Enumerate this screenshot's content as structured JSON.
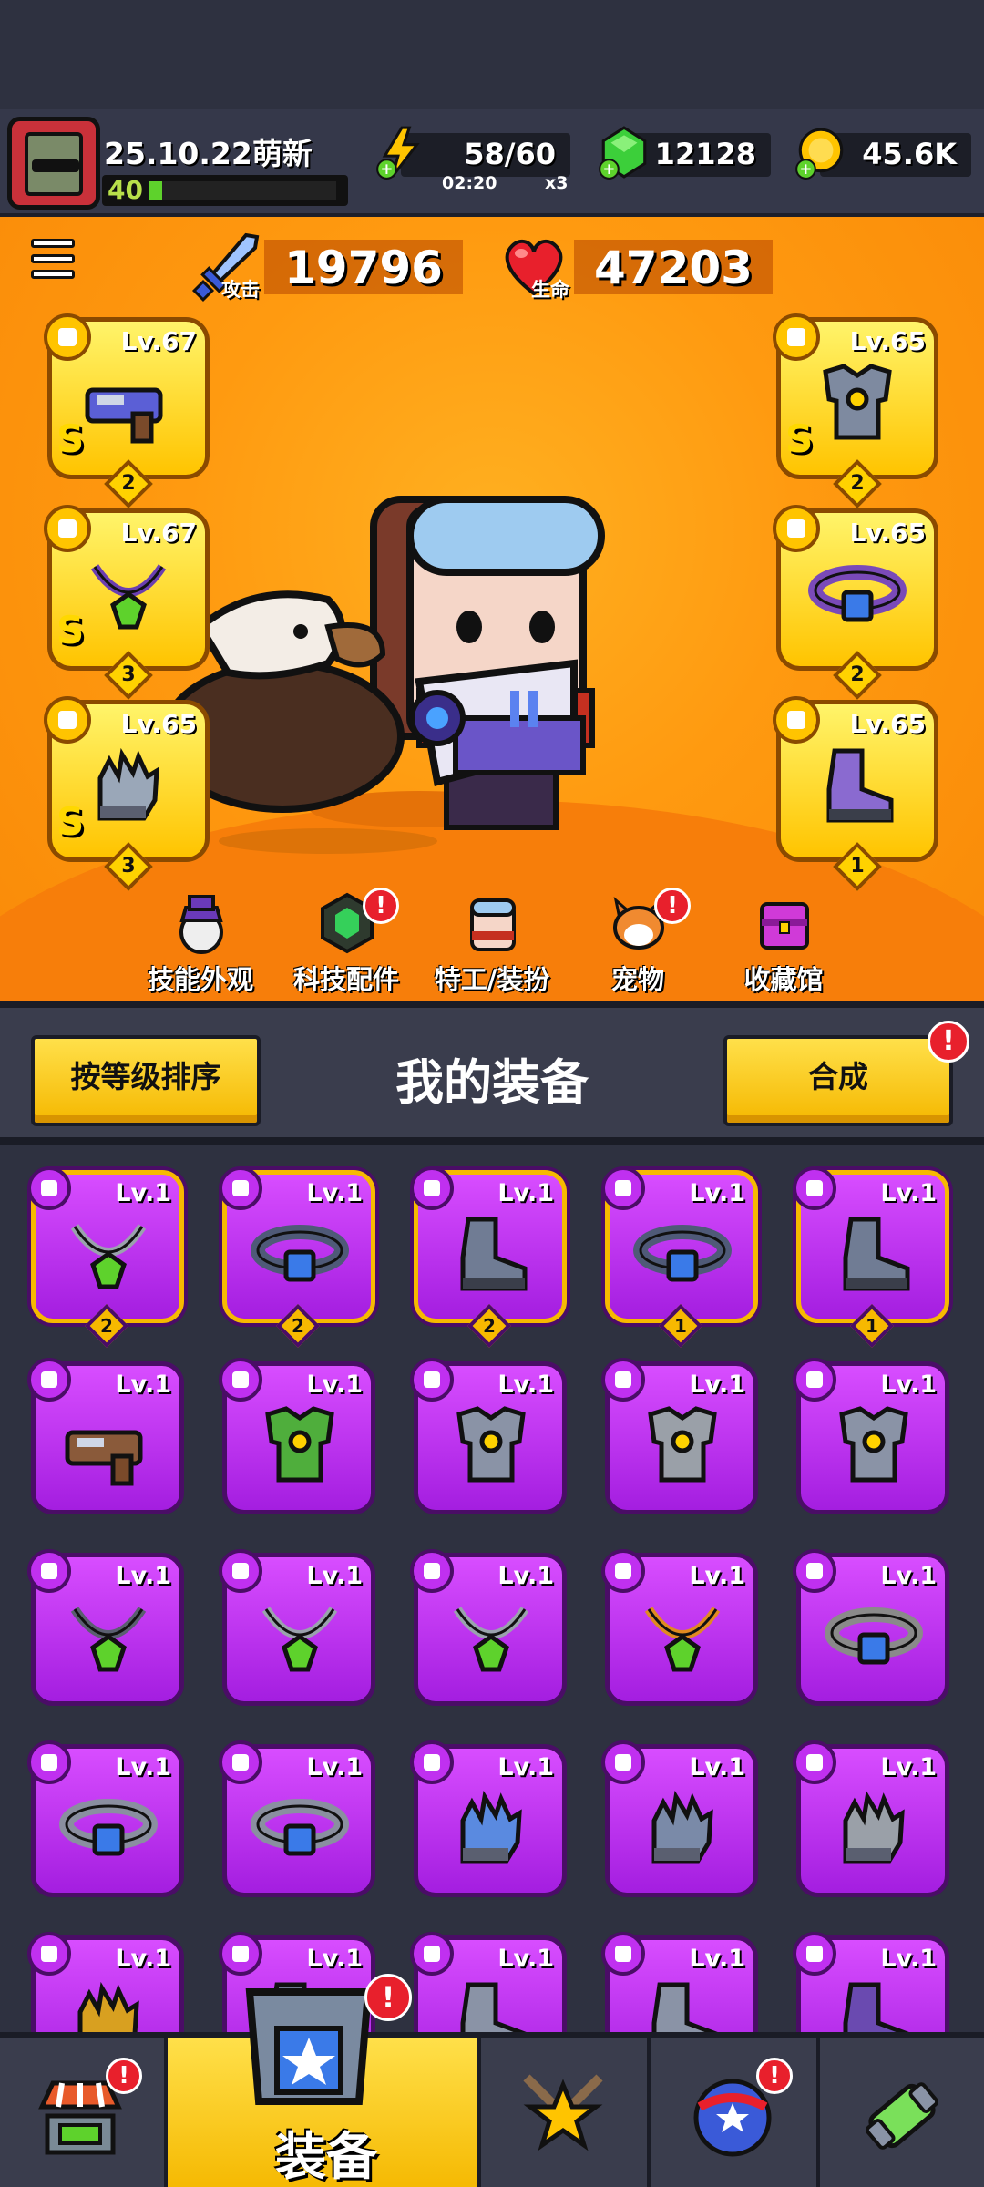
{
  "player": {
    "name": "25.10.22萌新",
    "level": "40",
    "xp_fraction": 0.07
  },
  "resources": {
    "energy": {
      "value": "58/60",
      "timer": "02:20",
      "multiplier": "x3"
    },
    "gems": {
      "value": "12128"
    },
    "gold": {
      "value": "45.6K"
    }
  },
  "stats": {
    "attack": {
      "label": "攻击",
      "value": "19796"
    },
    "hp": {
      "label": "生命",
      "value": "47203"
    }
  },
  "equipped": [
    {
      "slot": "weapon",
      "level": "Lv.67",
      "rank": "S",
      "count": "2",
      "color": "#5b5fd6"
    },
    {
      "slot": "necklace",
      "level": "Lv.67",
      "rank": "S",
      "count": "3",
      "color": "#6b3fb0"
    },
    {
      "slot": "gloves",
      "level": "Lv.65",
      "rank": "S",
      "count": "3",
      "color": "#9aa7b8"
    },
    {
      "slot": "armor",
      "level": "Lv.65",
      "rank": "S",
      "count": "2",
      "color": "#7e8aa0"
    },
    {
      "slot": "belt",
      "level": "Lv.65",
      "rank": "",
      "count": "2",
      "color": "#7a4ab8"
    },
    {
      "slot": "boots",
      "level": "Lv.65",
      "rank": "",
      "count": "1",
      "color": "#8a6ad0"
    }
  ],
  "hero_nav": [
    {
      "label": "技能外观",
      "alert": false
    },
    {
      "label": "科技配件",
      "alert": true
    },
    {
      "label": "特工/装扮",
      "alert": false
    },
    {
      "label": "宠物",
      "alert": true
    },
    {
      "label": "收藏馆",
      "alert": false
    }
  ],
  "equipment_header": {
    "sort_label": "按等级排序",
    "title": "我的装备",
    "merge_label": "合成",
    "merge_alert": "!"
  },
  "inventory": [
    {
      "type": "necklace",
      "level": "Lv.1",
      "count": "2",
      "gold": true,
      "color": "#9aa2ad"
    },
    {
      "type": "belt",
      "level": "Lv.1",
      "count": "2",
      "gold": true,
      "color": "#4f5a78"
    },
    {
      "type": "boots",
      "level": "Lv.1",
      "count": "2",
      "gold": true,
      "color": "#707c94"
    },
    {
      "type": "belt",
      "level": "Lv.1",
      "count": "1",
      "gold": true,
      "color": "#4f5a78"
    },
    {
      "type": "boots",
      "level": "Lv.1",
      "count": "1",
      "gold": true,
      "color": "#707c94"
    },
    {
      "type": "weapon",
      "level": "Lv.1",
      "count": "",
      "gold": false,
      "color": "#8a5a3a"
    },
    {
      "type": "armor",
      "level": "Lv.1",
      "count": "",
      "gold": false,
      "color": "#4fae3c"
    },
    {
      "type": "armor",
      "level": "Lv.1",
      "count": "",
      "gold": false,
      "color": "#8a93a6"
    },
    {
      "type": "armor",
      "level": "Lv.1",
      "count": "",
      "gold": false,
      "color": "#9aa0a8"
    },
    {
      "type": "armor",
      "level": "Lv.1",
      "count": "",
      "gold": false,
      "color": "#8a93a6"
    },
    {
      "type": "necklace",
      "level": "Lv.1",
      "count": "",
      "gold": false,
      "color": "#5a5f70"
    },
    {
      "type": "necklace",
      "level": "Lv.1",
      "count": "",
      "gold": false,
      "color": "#9aa2ad"
    },
    {
      "type": "necklace",
      "level": "Lv.1",
      "count": "",
      "gold": false,
      "color": "#9aa2ad"
    },
    {
      "type": "necklace",
      "level": "Lv.1",
      "count": "",
      "gold": false,
      "color": "#e08a20"
    },
    {
      "type": "belt",
      "level": "Lv.1",
      "count": "",
      "gold": false,
      "color": "#8a8a8a"
    },
    {
      "type": "belt",
      "level": "Lv.1",
      "count": "",
      "gold": false,
      "color": "#8a8fa0"
    },
    {
      "type": "belt",
      "level": "Lv.1",
      "count": "",
      "gold": false,
      "color": "#8a8fa0"
    },
    {
      "type": "gloves",
      "level": "Lv.1",
      "count": "",
      "gold": false,
      "color": "#5a8ae0"
    },
    {
      "type": "gloves",
      "level": "Lv.1",
      "count": "",
      "gold": false,
      "color": "#7a8aa8"
    },
    {
      "type": "gloves",
      "level": "Lv.1",
      "count": "",
      "gold": false,
      "color": "#9aa0a8"
    },
    {
      "type": "gloves",
      "level": "Lv.1",
      "count": "",
      "gold": false,
      "color": "#d8a020"
    },
    {
      "type": "boots",
      "level": "Lv.1",
      "count": "",
      "gold": false,
      "color": "#707c94"
    },
    {
      "type": "boots",
      "level": "Lv.1",
      "count": "",
      "gold": false,
      "color": "#8a93a6"
    },
    {
      "type": "boots",
      "level": "Lv.1",
      "count": "",
      "gold": false,
      "color": "#8a93a6"
    },
    {
      "type": "boots",
      "level": "Lv.1",
      "count": "",
      "gold": false,
      "color": "#6a4ab0"
    }
  ],
  "bottom_nav": [
    {
      "id": "shop",
      "label": "",
      "alert": true
    },
    {
      "id": "equipment",
      "label": "装备",
      "alert": true,
      "active": true
    },
    {
      "id": "battle",
      "label": "",
      "alert": false
    },
    {
      "id": "challenge",
      "label": "",
      "alert": true
    },
    {
      "id": "evolve",
      "label": "",
      "alert": false
    }
  ],
  "colors": {
    "hero_bg": "#ff9a10",
    "rare_purple": "#b42ee8",
    "gold_frame": "#ffc400",
    "alert_red": "#e8202c"
  }
}
